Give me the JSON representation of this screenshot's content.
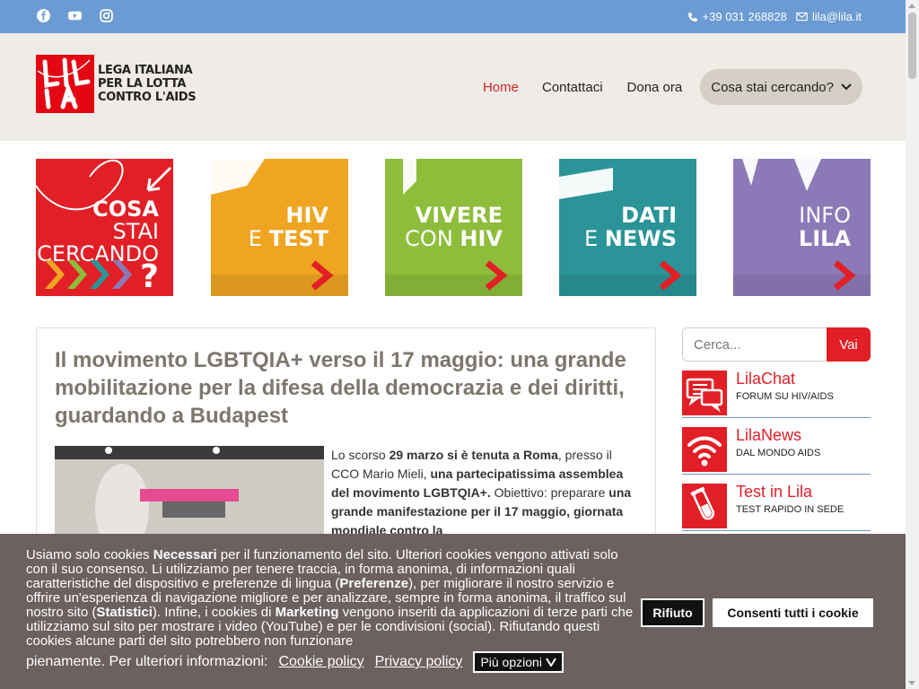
{
  "topbar": {
    "social": [
      "facebook-icon",
      "youtube-icon",
      "instagram-icon"
    ],
    "phone": "+39 031 268828",
    "email": "lila@lila.it",
    "bg_color": "#6b9bd2"
  },
  "header": {
    "logo_text_line1": "LEGA ITALIANA",
    "logo_text_line2": "PER LA LOTTA",
    "logo_text_line3": "CONTRO L'AIDS",
    "nav": {
      "home": "Home",
      "contacts": "Contattaci",
      "donate": "Dona ora",
      "search_menu": "Cosa stai cercando?"
    }
  },
  "tiles": [
    {
      "line1": "COSA",
      "line2": "STAI",
      "line3": "CERCANDO",
      "color": "#e21f26"
    },
    {
      "line1": "HIV",
      "line2": "E TEST",
      "color": "#efa521"
    },
    {
      "line1": "VIVERE",
      "line2": "CON HIV",
      "color": "#8dbd3a"
    },
    {
      "line1": "DATI",
      "line2": "E NEWS",
      "color": "#2a9498"
    },
    {
      "line1": "INFO",
      "line2": "LILA",
      "color": "#8c7ab8"
    }
  ],
  "article": {
    "title": "Il movimento LGBTQIA+ verso il 17 maggio: una grande mobilitazione per la difesa della democrazia e dei diritti, guardando a Budapest",
    "p1": "Lo scorso ",
    "b1": "29 marzo si è tenuta a Roma",
    "p2": ", presso il CCO Mario Mieli, ",
    "b2": "una partecipatissima assemblea del movimento LGBTQIA+.",
    "p3": " Obiettivo: preparare ",
    "b3": "una grande manifestazione per il 17 maggio, giornata mondiale contro la"
  },
  "sidebar": {
    "search_placeholder": "Cerca...",
    "search_button": "Vai",
    "items": [
      {
        "title": "LilaChat",
        "subtitle": "FORUM SU HIV/AIDS",
        "icon": "chat-icon"
      },
      {
        "title": "LilaNews",
        "subtitle": "DAL MONDO AIDS",
        "icon": "wifi-icon"
      },
      {
        "title": "Test in Lila",
        "subtitle": "TEST RAPIDO IN SEDE",
        "icon": "test-tube-icon"
      }
    ]
  },
  "cookie": {
    "t1": "Usiamo solo cookies ",
    "b1": "Necessari",
    "t2": " per il funzionamento del sito. Ulteriori cookies vengono attivati solo con il suo consenso. Li utilizziamo per tenere traccia, in forma anonima, di informazioni quali caratteristiche del dispositivo e preferenze di lingua (",
    "b2": "Preferenze",
    "t3": "), per migliorare il nostro servizio e offrire un'esperienza di navigazione migliore e per analizzare, sempre in forma anonima, il traffico sul nostro sito (",
    "b3": "Statistici",
    "t4": "). Infine, i cookies di ",
    "b4": "Marketing",
    "t5": " vengono inseriti da applicazioni di terze parti che utilizziamo sul sito per mostrare i video (YouTube) e per le condivisioni (social). Rifiutando questi cookies alcune parti del sito potrebbero non funzionare",
    "t6": "pienamente. Per ulteriori informazioni:",
    "cookie_policy": "Cookie policy",
    "privacy_policy": "Privacy policy",
    "more_options": "Più opzioni",
    "refuse": "Rifiuto",
    "accept_all": "Consenti tutti i cookie"
  }
}
